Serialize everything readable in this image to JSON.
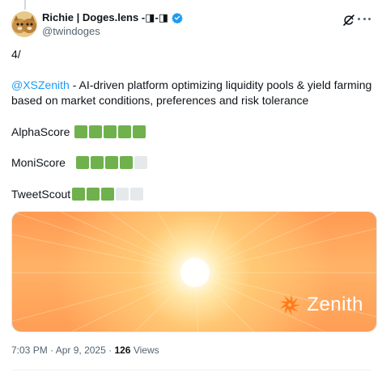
{
  "author": {
    "display_name": "Richie | Doges.lens -◨-◨",
    "handle": "@twindoges"
  },
  "tweet": {
    "number": "4/",
    "mention": "@XSZenith",
    "description": " - AI-driven platform optimizing liquidity pools & yield farming based on market conditions, preferences and risk tolerance"
  },
  "scores": [
    {
      "label": "AlphaScore",
      "filled": 5,
      "total": 5
    },
    {
      "label": "MoniScore",
      "filled": 4,
      "total": 5
    },
    {
      "label": "TweetScout",
      "filled": 3,
      "total": 5
    }
  ],
  "card": {
    "brand_name": "Zenith"
  },
  "meta": {
    "time": "7:03 PM",
    "separator": "·",
    "date": "Apr 9, 2025",
    "views_count": "126",
    "views_label": "Views"
  },
  "colors": {
    "score_on": "#6fb14c",
    "score_off": "#e6e9eb",
    "link": "#1d9bf0",
    "verified": "#1d9bf0"
  }
}
